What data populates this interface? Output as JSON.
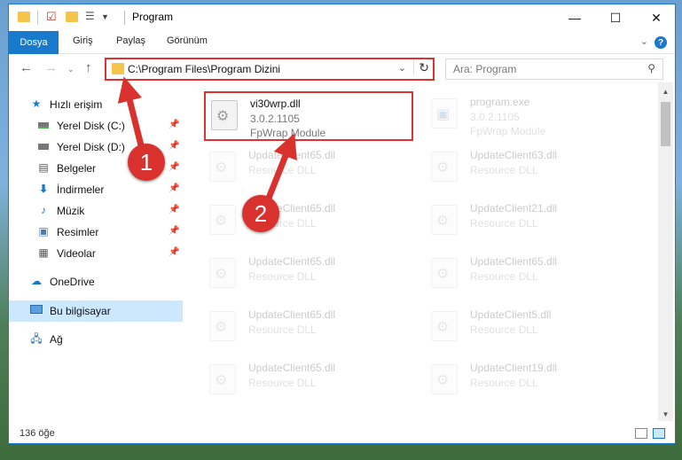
{
  "window": {
    "title": "Program",
    "controls": {
      "minimize": "—",
      "maximize": "☐",
      "close": "✕"
    }
  },
  "ribbon": {
    "file_tab": "Dosya",
    "tabs": [
      "Giriş",
      "Paylaş",
      "Görünüm"
    ],
    "help": "?"
  },
  "navigation": {
    "address": "C:\\Program Files\\Program Dizini",
    "search_placeholder": "Ara: Program"
  },
  "sidebar": {
    "items": [
      {
        "label": "Hızlı erişim",
        "icon": "star-icon"
      },
      {
        "label": "Yerel Disk (C:)",
        "icon": "drive-icon",
        "pinned": true
      },
      {
        "label": "Yerel Disk (D:)",
        "icon": "drive-icon",
        "pinned": true
      },
      {
        "label": "Belgeler",
        "icon": "documents-icon",
        "pinned": true
      },
      {
        "label": "İndirmeler",
        "icon": "download-icon",
        "pinned": true
      },
      {
        "label": "Müzik",
        "icon": "music-icon",
        "pinned": true
      },
      {
        "label": "Resimler",
        "icon": "pictures-icon",
        "pinned": true
      },
      {
        "label": "Videolar",
        "icon": "videos-icon",
        "pinned": true
      },
      {
        "label": "OneDrive",
        "icon": "cloud-icon"
      },
      {
        "label": "Bu bilgisayar",
        "icon": "computer-icon",
        "selected": true
      },
      {
        "label": "Ağ",
        "icon": "network-icon"
      }
    ]
  },
  "files": [
    {
      "name": "vi30wrp.dll",
      "version": "3.0.2.1105",
      "desc": "FpWrap Module"
    },
    {
      "name": "program.exe",
      "version": "3.0.2.1105",
      "desc": "FpWrap Module"
    },
    {
      "name": "UpdateClient65.dll",
      "version": "Resource DLL"
    },
    {
      "name": "UpdateClient63.dll",
      "version": "Resource DLL"
    },
    {
      "name": "UpdateClient65.dll",
      "version": "Resource DLL"
    },
    {
      "name": "UpdateClient21.dll",
      "version": "Resource DLL"
    },
    {
      "name": "UpdateClient65.dll",
      "version": "Resource DLL"
    },
    {
      "name": "UpdateClient65.dll",
      "version": "Resource DLL"
    },
    {
      "name": "UpdateClient65.dll",
      "version": "Resource DLL"
    },
    {
      "name": "UpdateClient5.dll",
      "version": "Resource DLL"
    },
    {
      "name": "UpdateClient65.dll",
      "version": "Resource DLL"
    },
    {
      "name": "UpdateClient19.dll",
      "version": "Resource DLL"
    }
  ],
  "status": {
    "count": "136 öğe"
  },
  "callouts": {
    "one": "1",
    "two": "2"
  },
  "colors": {
    "accent": "#1979ca",
    "highlight": "#e03030",
    "callout": "#d9322e"
  }
}
